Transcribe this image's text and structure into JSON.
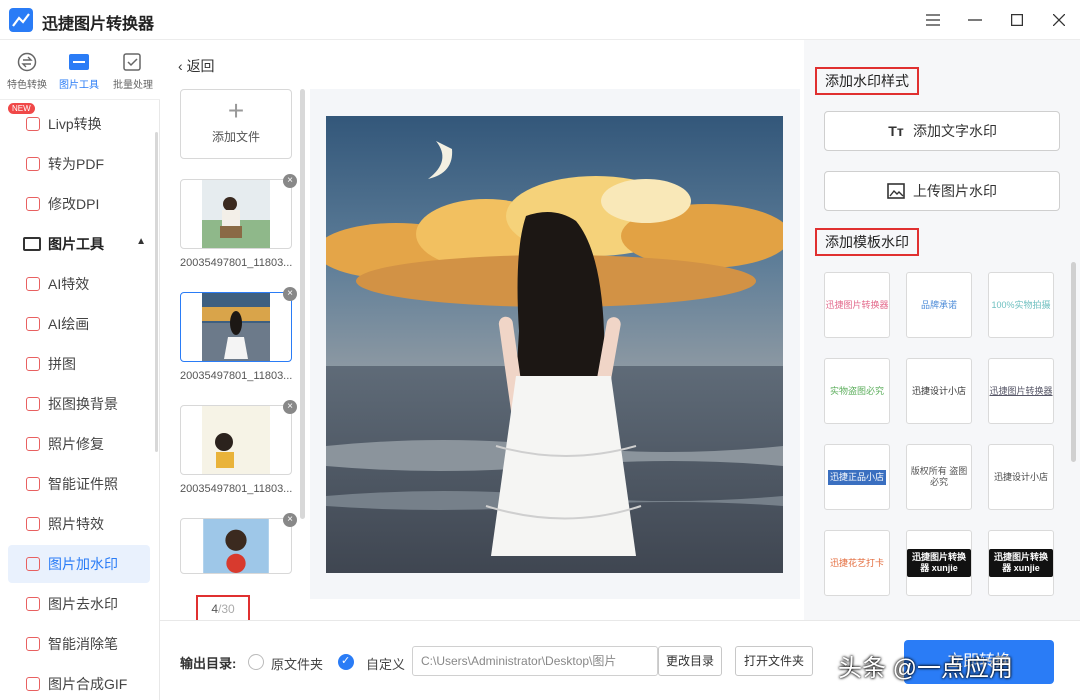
{
  "app": {
    "title": "迅捷图片转换器"
  },
  "tooltabs": [
    {
      "label": "特色转换",
      "icon": "swap-icon"
    },
    {
      "label": "图片工具",
      "icon": "image-tools-icon"
    },
    {
      "label": "批量处理",
      "icon": "batch-icon"
    }
  ],
  "sidebar": {
    "new_badge": "NEW",
    "items": [
      {
        "label": "Livp转换",
        "icon": "livp-icon"
      },
      {
        "label": "转为PDF",
        "icon": "pdf-icon"
      },
      {
        "label": "修改DPI",
        "icon": "dpi-icon"
      }
    ],
    "group": {
      "label": "图片工具",
      "icon": "image-tools-icon"
    },
    "group_items": [
      {
        "label": "AI特效",
        "icon": "ai-effect-icon"
      },
      {
        "label": "AI绘画",
        "icon": "ai-paint-icon"
      },
      {
        "label": "拼图",
        "icon": "collage-icon"
      },
      {
        "label": "抠图换背景",
        "icon": "cutout-icon"
      },
      {
        "label": "照片修复",
        "icon": "repair-icon"
      },
      {
        "label": "智能证件照",
        "icon": "id-photo-icon"
      },
      {
        "label": "照片特效",
        "icon": "photo-effect-icon"
      },
      {
        "label": "图片加水印",
        "icon": "add-watermark-icon"
      },
      {
        "label": "图片去水印",
        "icon": "remove-watermark-icon"
      },
      {
        "label": "智能消除笔",
        "icon": "eraser-pen-icon"
      },
      {
        "label": "图片合成GIF",
        "icon": "gif-icon"
      }
    ]
  },
  "back": {
    "label": "返回"
  },
  "files": {
    "add_label": "添加文件",
    "items": [
      {
        "name": "20035497801_11803..."
      },
      {
        "name": "20035497801_11803..."
      },
      {
        "name": "20035497801_11803..."
      }
    ],
    "counter_current": "4",
    "counter_total": "/30"
  },
  "right_panel": {
    "style_title": "添加水印样式",
    "text_watermark": "添加文字水印",
    "image_watermark": "上传图片水印",
    "template_title": "添加模板水印",
    "templates": [
      "迅捷图片转换器",
      "品牌承诺",
      "100%实物拍摄",
      "实物盗图必究",
      "迅捷设计小店",
      "迅捷图片转换器",
      "迅捷正品小店",
      "版权所有 盗图必究",
      "迅捷设计小店",
      "迅捷花艺打卡",
      "迅捷图片转换器 xunjie",
      "迅捷图片转换器 xunjie"
    ]
  },
  "footer": {
    "output_label": "输出目录:",
    "option_original": "原文件夹",
    "option_custom": "自定义",
    "path": "C:\\Users\\Administrator\\Desktop\\图片",
    "change_dir": "更改目录",
    "open_folder": "打开文件夹",
    "convert": "立即转换"
  },
  "overlay_watermark": "头条 @一点应用",
  "colors": {
    "accent": "#2a7cf6",
    "highlight_box": "#e03030"
  }
}
